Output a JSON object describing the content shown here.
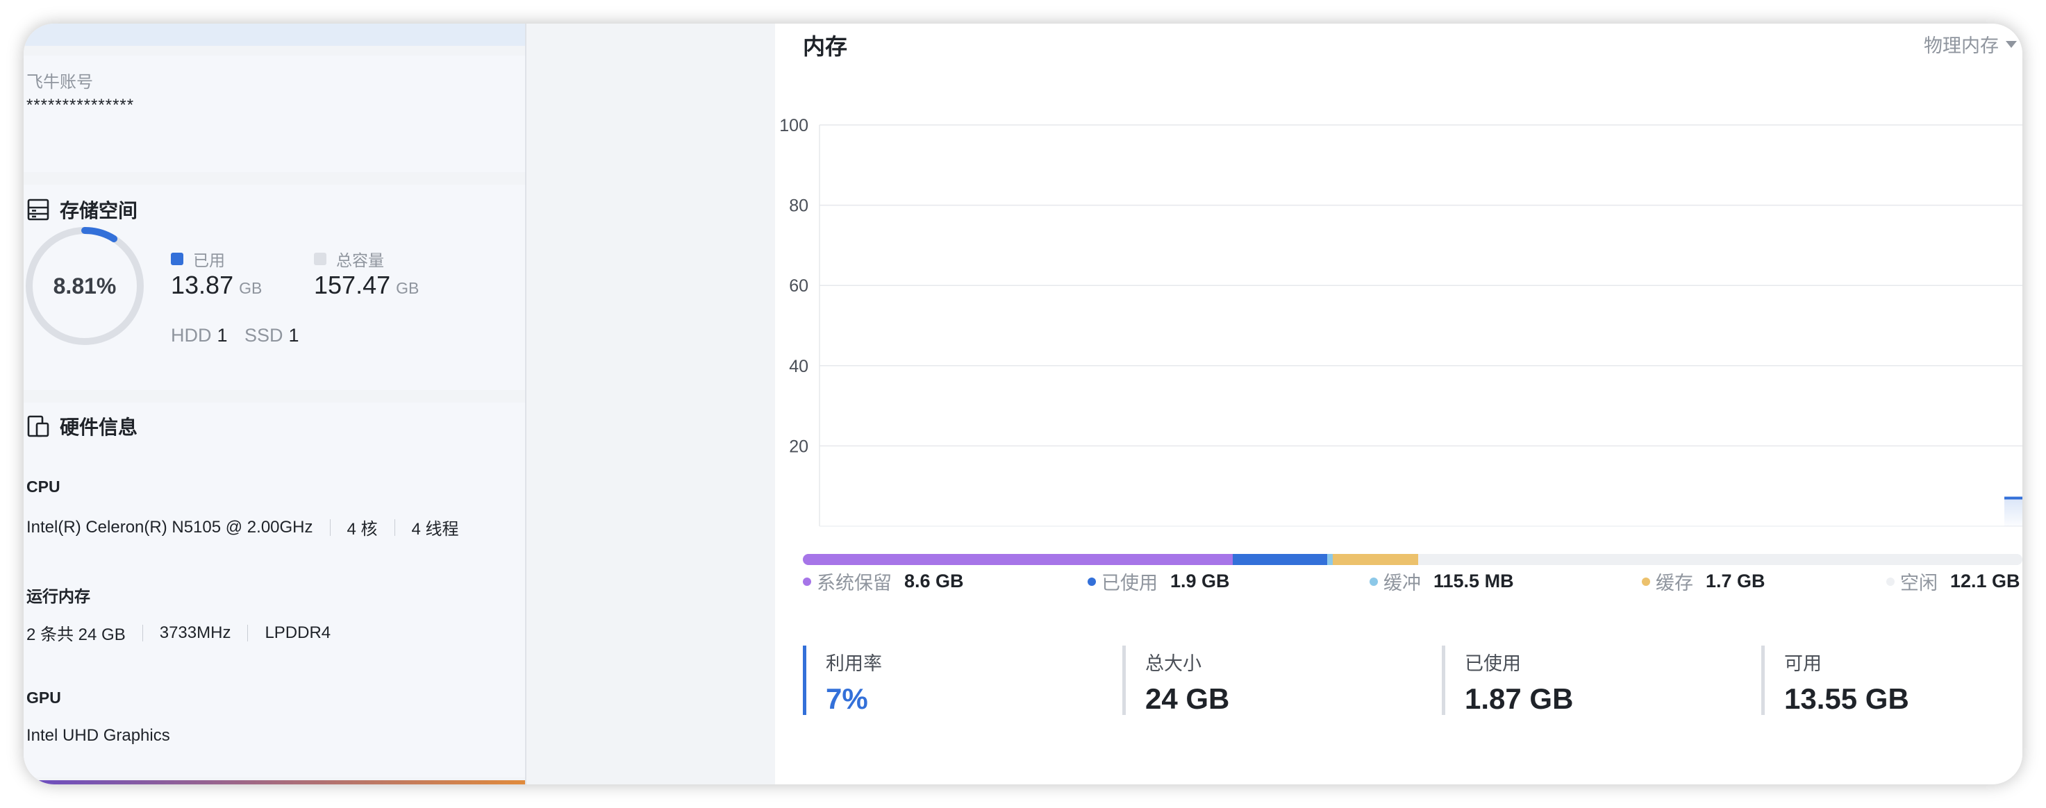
{
  "account": {
    "label": "飞牛账号",
    "value": "***************"
  },
  "storage": {
    "title": "存储空间",
    "percent_label": "8.81%",
    "percent": 8.81,
    "used_label": "已用",
    "used_value": "13.87",
    "used_unit": "GB",
    "total_label": "总容量",
    "total_value": "157.47",
    "total_unit": "GB",
    "hdd_label": "HDD",
    "hdd_count": "1",
    "ssd_label": "SSD",
    "ssd_count": "1",
    "colors": {
      "used": "#3370d9",
      "total": "#dcdfe5",
      "ring_track": "#dcdfe5"
    }
  },
  "hardware": {
    "title": "硬件信息",
    "cpu": {
      "label": "CPU",
      "model": "Intel(R) Celeron(R) N5105 @ 2.00GHz",
      "cores": "4 核",
      "threads": "4 线程"
    },
    "ram": {
      "label": "运行内存",
      "config": "2 条共 24 GB",
      "speed": "3733MHz",
      "type": "LPDDR4"
    },
    "gpu": {
      "label": "GPU",
      "model": "Intel UHD Graphics"
    }
  },
  "memory": {
    "title": "内存",
    "selector": "物理内存",
    "breakdown": [
      {
        "name": "系统保留",
        "value": "8.6 GB",
        "color": "#a675e8",
        "gb": 8.6
      },
      {
        "name": "已使用",
        "value": "1.9 GB",
        "color": "#3370d9",
        "gb": 1.9
      },
      {
        "name": "缓冲",
        "value": "115.5 MB",
        "color": "#8cc8e8",
        "gb": 0.1128
      },
      {
        "name": "缓存",
        "value": "1.7 GB",
        "color": "#ecc16c",
        "gb": 1.7
      },
      {
        "name": "空闲",
        "value": "12.1 GB",
        "color": "#eef0f3",
        "gb": 12.1
      }
    ],
    "stats": [
      {
        "label": "利用率",
        "value": "7%"
      },
      {
        "label": "总大小",
        "value": "24 GB"
      },
      {
        "label": "已使用",
        "value": "1.87 GB"
      },
      {
        "label": "可用",
        "value": "13.55 GB"
      }
    ]
  },
  "chart_data": {
    "type": "line",
    "title": "",
    "xlabel": "",
    "ylabel": "",
    "ylim": [
      0,
      100
    ],
    "yticks": [
      20,
      40,
      60,
      80,
      100
    ],
    "grid": true,
    "series": [
      {
        "values": [
          7,
          7
        ],
        "x_fraction": [
          0.985,
          1.0
        ],
        "color": "#3370d9"
      }
    ]
  }
}
